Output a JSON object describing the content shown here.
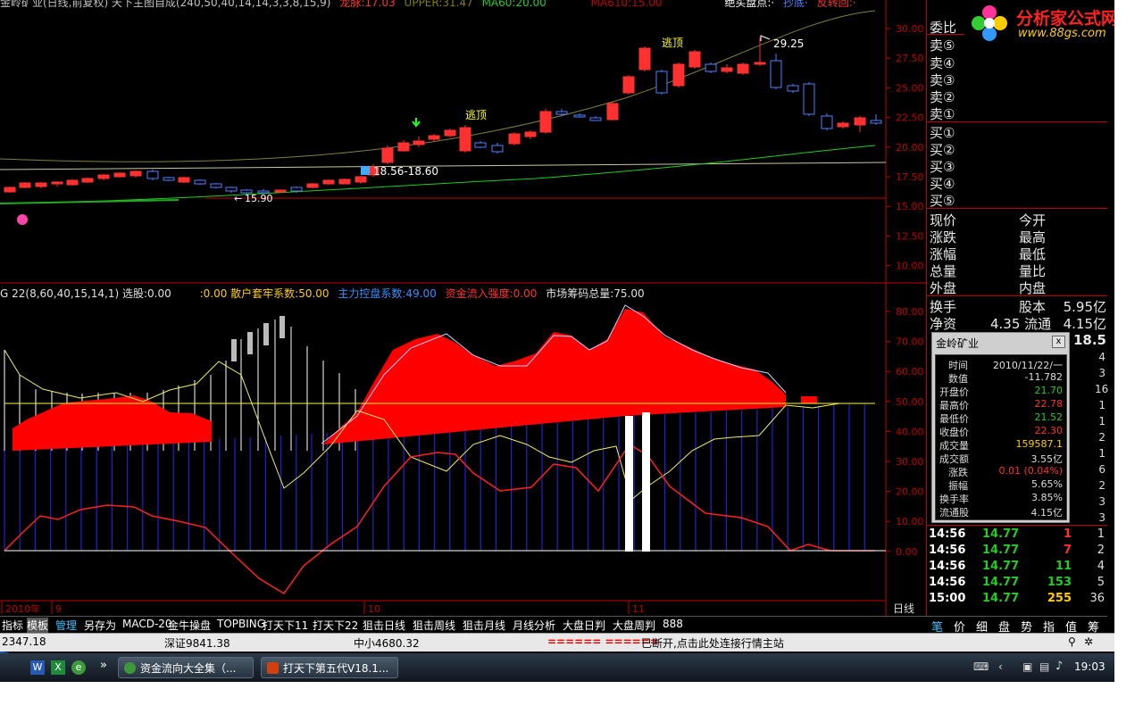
{
  "window": {
    "title_line": {
      "main": "金岭矿业(日线,前复权) 天下主图自成(240,50,40,14,14,3,3,8,15,9)",
      "ma1": "龙脉:17.03",
      "ma2": "UPPER:31.47",
      "ma3": "MA60:20.00",
      "ma4": "MA610:15.00",
      "right1": "绝买盘点:·",
      "right2": "抄底·",
      "right3": "反转回:·"
    }
  },
  "main_chart": {
    "y_ticks": [
      "30.00",
      "27.50",
      "25.00",
      "22.50",
      "20.00",
      "17.50",
      "15.00",
      "12.50",
      "10.00"
    ],
    "annotations": {
      "peak_top": "逃顶",
      "mid_top": "逃顶",
      "high_label": "29.25",
      "low_label": "15.90",
      "breakout_label": "18.56-18.60"
    },
    "colors": {
      "up": "#ff3030",
      "down": "#5080ff",
      "background": "#000000",
      "axis_red": "#c00000"
    }
  },
  "indicator": {
    "title": {
      "name": "G 22(8,60,40,15,14,1) 选股:0.00",
      "retail": ":0.00 散户套牢系数:50.00",
      "main_force": "主力控盘系数:49.00",
      "inflow": "资金流入强度:0.00",
      "chips": "市场筹码总量:75.00"
    },
    "y_ticks": [
      "80.00",
      "70.00",
      "60.00",
      "50.00",
      "40.00",
      "30.00",
      "20.00",
      "10.00",
      "0.00"
    ]
  },
  "time_axis": {
    "labels": [
      "2010年",
      "9",
      "10",
      "11"
    ],
    "period": "日线"
  },
  "right_panel": {
    "order_book": {
      "title": "委比",
      "asks": [
        "卖⑤",
        "卖④",
        "卖③",
        "卖②",
        "卖①"
      ],
      "bids": [
        "买①",
        "买②",
        "买③",
        "买④",
        "买⑤"
      ]
    },
    "quote": [
      {
        "left": "现价",
        "mid": "今开",
        "value": ""
      },
      {
        "left": "涨跌",
        "mid": "最高",
        "value": ""
      },
      {
        "left": "涨幅",
        "mid": "最低",
        "value": ""
      },
      {
        "left": "总量",
        "mid": "量比",
        "value": ""
      },
      {
        "left": "外盘",
        "mid": "内盘",
        "value": ""
      },
      {
        "left": "换手",
        "mid": "股本",
        "value": "5.95亿"
      },
      {
        "left": "净资",
        "mid": "4.35 流通",
        "value": "4.15亿"
      }
    ],
    "extra_value": "18.5",
    "side_digits": [
      "4",
      "3",
      "16",
      "1",
      "1",
      "2",
      "1",
      "6",
      "2",
      "3",
      "3",
      "1",
      "2",
      "4",
      "5",
      "36"
    ]
  },
  "logo": {
    "name": "分析家公式网",
    "url_text": "www.88gs.com"
  },
  "popup": {
    "title": "金岭矿业",
    "close": "x",
    "rows": [
      {
        "k": "时间",
        "v": "2010/11/22/一",
        "c": "#dddddd"
      },
      {
        "k": "数值",
        "v": "-11.782",
        "c": "#dddddd"
      },
      {
        "k": "开盘价",
        "v": "21.70",
        "c": "#22cc22"
      },
      {
        "k": "最高价",
        "v": "22.78",
        "c": "#ff3030"
      },
      {
        "k": "最低价",
        "v": "21.52",
        "c": "#22cc22"
      },
      {
        "k": "收盘价",
        "v": "22.30",
        "c": "#ff3030"
      },
      {
        "k": "成交量",
        "v": "159587.1",
        "c": "#ffcc00"
      },
      {
        "k": "成交额",
        "v": "3.55亿",
        "c": "#dddddd"
      },
      {
        "k": "涨跌",
        "v": "0.01 (0.04%)",
        "c": "#ff3030"
      },
      {
        "k": "振幅",
        "v": "5.65%",
        "c": "#dddddd"
      },
      {
        "k": "换手率",
        "v": "3.85%",
        "c": "#dddddd"
      },
      {
        "k": "流通股",
        "v": "4.15亿",
        "c": "#dddddd"
      }
    ]
  },
  "ticks": [
    {
      "time": "14:56",
      "price": "14.77",
      "vol": "1",
      "vc": "#ff3030",
      "n": "1"
    },
    {
      "time": "14:56",
      "price": "14.77",
      "vol": "7",
      "vc": "#ff3030",
      "n": "2"
    },
    {
      "time": "14:56",
      "price": "14.77",
      "vol": "11",
      "vc": "#22cc22",
      "n": "4"
    },
    {
      "time": "14:56",
      "price": "14.77",
      "vol": "153",
      "vc": "#22cc22",
      "n": "5"
    },
    {
      "time": "15:00",
      "price": "14.77",
      "vol": "255",
      "vc": "#ffcc00",
      "n": "36"
    }
  ],
  "menu": [
    "指标",
    "模板",
    "管理",
    "另存为",
    "MACD-20",
    "金牛操盘",
    "TOPBING",
    "打天下11",
    "打天下22",
    "狙击日线",
    "狙击周线",
    "狙击月线",
    "月线分析",
    "大盘日判",
    "大盘周判",
    "888"
  ],
  "right_tabs": [
    "笔",
    "价",
    "细",
    "盘",
    "势",
    "指",
    "值",
    "筹"
  ],
  "status": {
    "sh": "2347.18",
    "sz": "深证9841.38",
    "sme": "中小4680.32",
    "msg": "已断开,点击此处连接行情主站"
  },
  "taskbar": {
    "btn1": "资金流向大全集（...",
    "btn2": "打天下第五代V18.1...",
    "clock": "19:03"
  }
}
